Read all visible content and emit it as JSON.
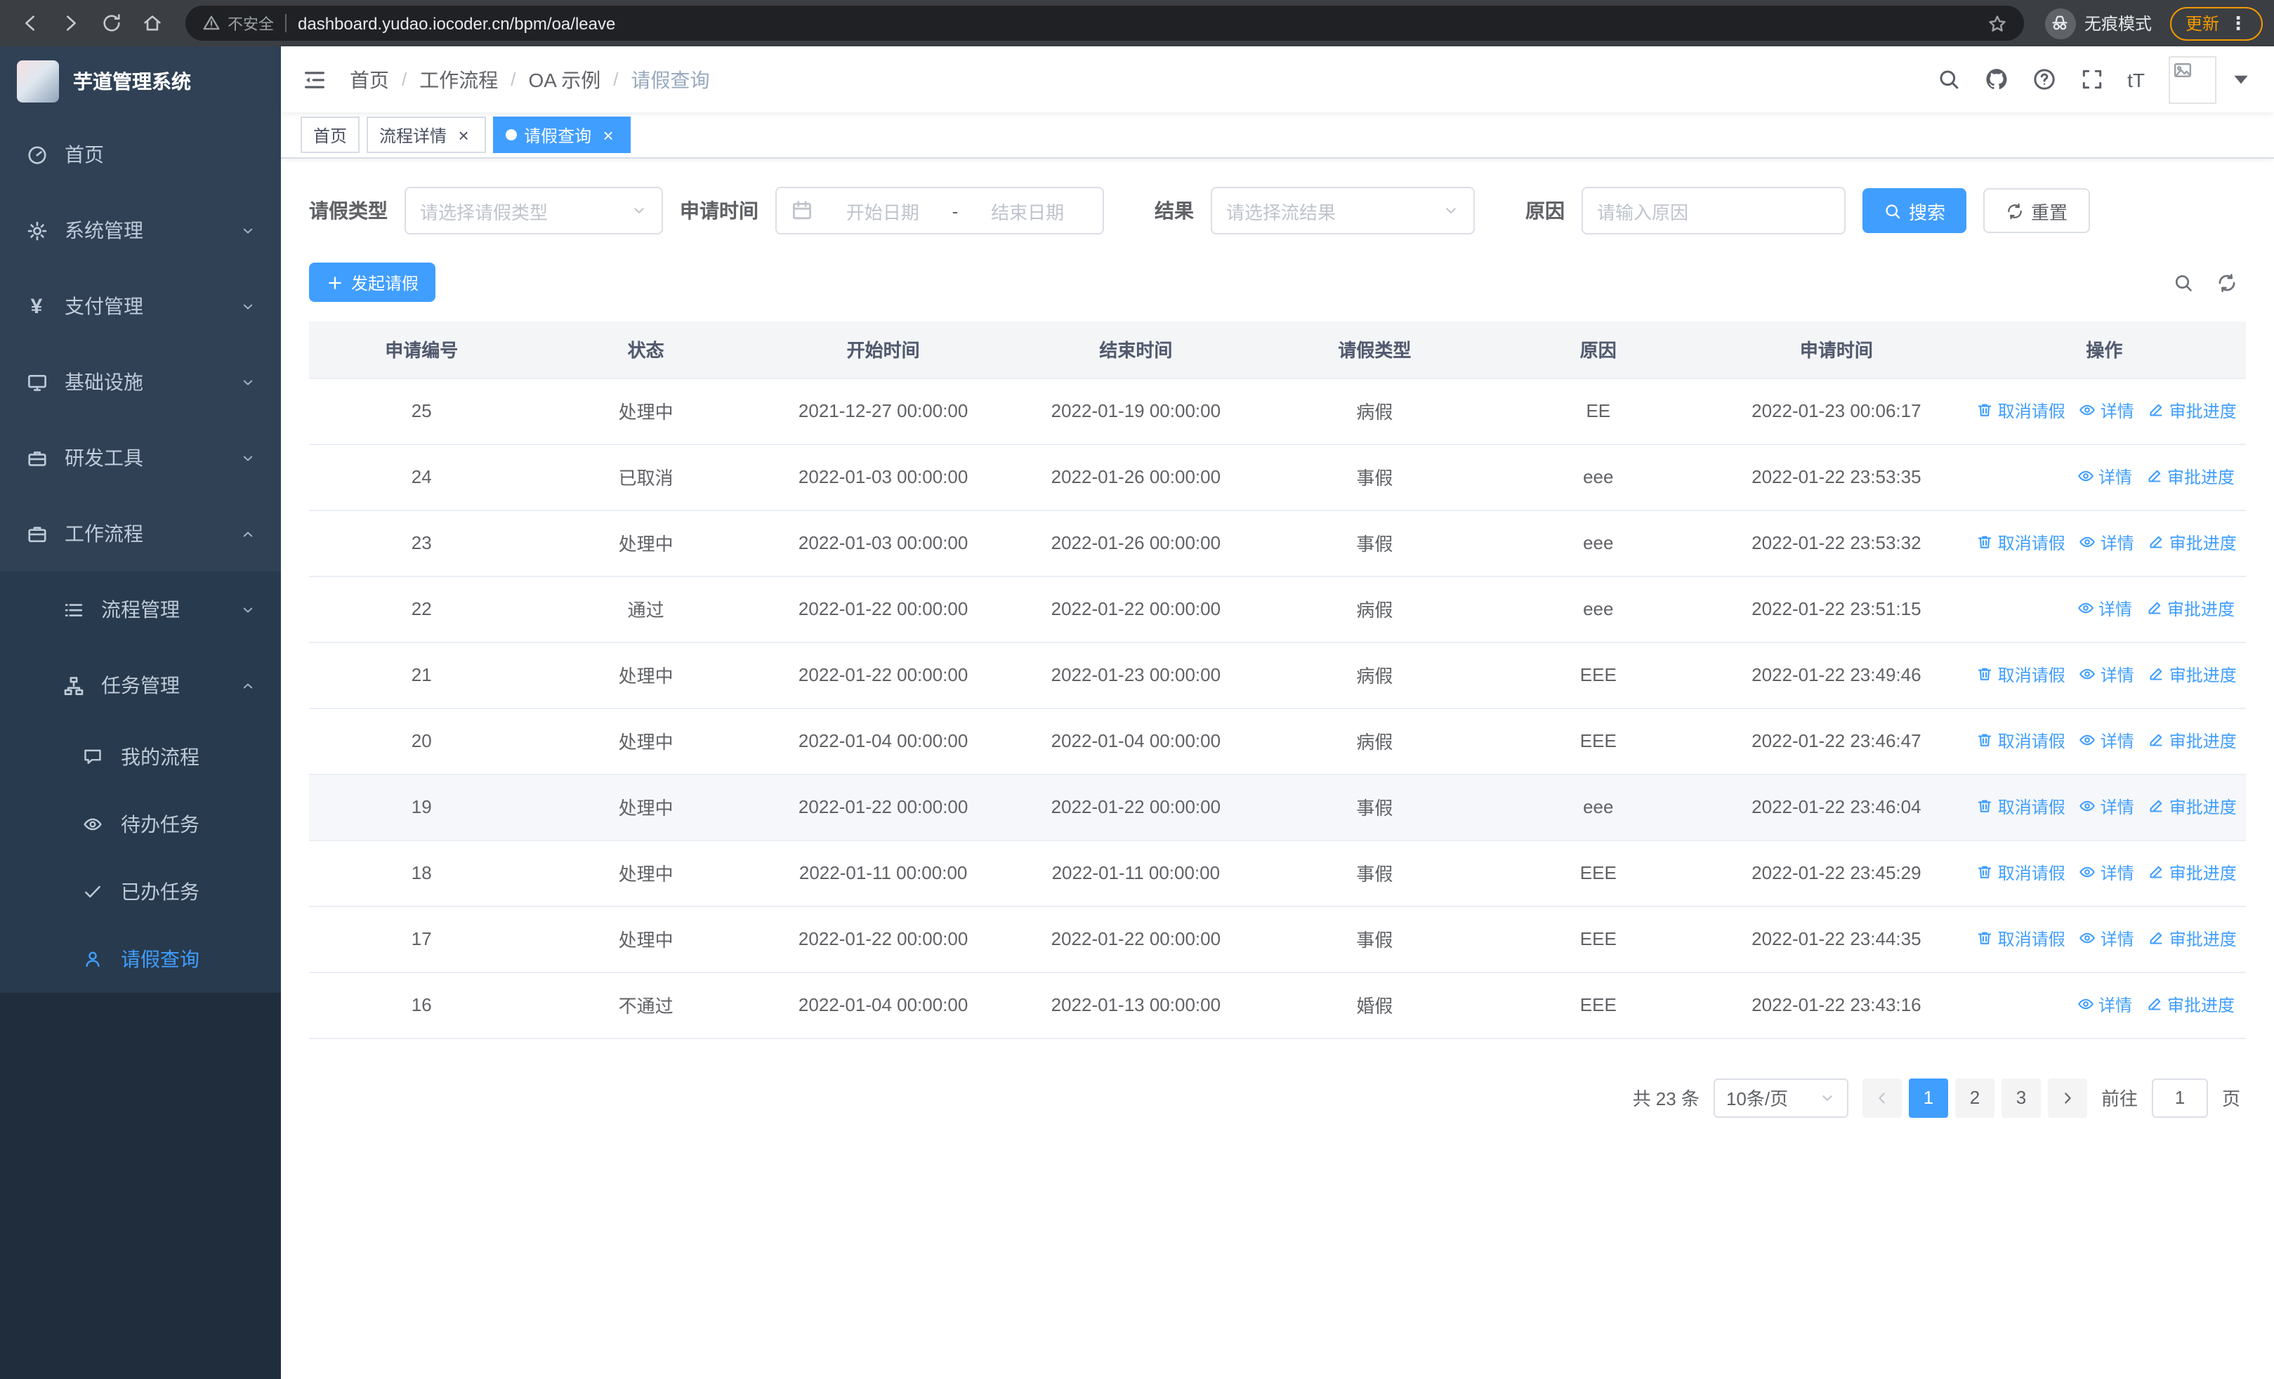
{
  "theme": {
    "accent": "#409EFF",
    "sidebar_bg": "#304156",
    "sidebar_dark_bg": "#1f2d3d",
    "table_header_bg": "#f4f5f7",
    "update_pill_color": "#f29900"
  },
  "browser": {
    "security_label": "不安全",
    "url": "dashboard.yudao.iocoder.cn/bpm/oa/leave",
    "incognito_label": "无痕模式",
    "update_label": "更新"
  },
  "icons": {
    "close": "×",
    "menu_dots": "⋮",
    "yen": "¥",
    "font_size": "tT"
  },
  "sidebar": {
    "logo_title": "芋道管理系统",
    "top_items": [
      {
        "label": "首页"
      },
      {
        "label": "系统管理"
      },
      {
        "label": "支付管理"
      },
      {
        "label": "基础设施"
      },
      {
        "label": "研发工具"
      },
      {
        "label": "工作流程"
      }
    ],
    "workflow_children": [
      {
        "label": "流程管理"
      },
      {
        "label": "任务管理"
      }
    ],
    "task_children": [
      {
        "label": "我的流程"
      },
      {
        "label": "待办任务"
      },
      {
        "label": "已办任务"
      },
      {
        "label": "请假查询"
      }
    ]
  },
  "header": {
    "breadcrumb": [
      "首页",
      "工作流程",
      "OA 示例",
      "请假查询"
    ],
    "separator": "/"
  },
  "tabs": [
    {
      "label": "首页"
    },
    {
      "label": "流程详情"
    },
    {
      "label": "请假查询"
    }
  ],
  "filters": {
    "leave_type_label": "请假类型",
    "leave_type_placeholder": "请选择请假类型",
    "apply_time_label": "申请时间",
    "start_date_placeholder": "开始日期",
    "date_separator": "-",
    "end_date_placeholder": "结束日期",
    "result_label": "结果",
    "result_placeholder": "请选择流结果",
    "reason_label": "原因",
    "reason_placeholder": "请输入原因",
    "search_button": "搜索",
    "reset_button": "重置"
  },
  "toolbar": {
    "create_button": "发起请假"
  },
  "table": {
    "columns": [
      "申请编号",
      "状态",
      "开始时间",
      "结束时间",
      "请假类型",
      "原因",
      "申请时间",
      "操作"
    ],
    "action_labels": {
      "cancel": "取消请假",
      "detail": "详情",
      "progress": "审批进度"
    },
    "rows": [
      {
        "id": "25",
        "status": "处理中",
        "start": "2021-12-27 00:00:00",
        "end": "2022-01-19 00:00:00",
        "type": "病假",
        "reason": "EE",
        "apply_time": "2022-01-23 00:06:17",
        "actions": [
          "cancel",
          "detail",
          "progress"
        ]
      },
      {
        "id": "24",
        "status": "已取消",
        "start": "2022-01-03 00:00:00",
        "end": "2022-01-26 00:00:00",
        "type": "事假",
        "reason": "eee",
        "apply_time": "2022-01-22 23:53:35",
        "actions": [
          "detail",
          "progress"
        ]
      },
      {
        "id": "23",
        "status": "处理中",
        "start": "2022-01-03 00:00:00",
        "end": "2022-01-26 00:00:00",
        "type": "事假",
        "reason": "eee",
        "apply_time": "2022-01-22 23:53:32",
        "actions": [
          "cancel",
          "detail",
          "progress"
        ]
      },
      {
        "id": "22",
        "status": "通过",
        "start": "2022-01-22 00:00:00",
        "end": "2022-01-22 00:00:00",
        "type": "病假",
        "reason": "eee",
        "apply_time": "2022-01-22 23:51:15",
        "actions": [
          "detail",
          "progress"
        ]
      },
      {
        "id": "21",
        "status": "处理中",
        "start": "2022-01-22 00:00:00",
        "end": "2022-01-23 00:00:00",
        "type": "病假",
        "reason": "EEE",
        "apply_time": "2022-01-22 23:49:46",
        "actions": [
          "cancel",
          "detail",
          "progress"
        ]
      },
      {
        "id": "20",
        "status": "处理中",
        "start": "2022-01-04 00:00:00",
        "end": "2022-01-04 00:00:00",
        "type": "病假",
        "reason": "EEE",
        "apply_time": "2022-01-22 23:46:47",
        "actions": [
          "cancel",
          "detail",
          "progress"
        ]
      },
      {
        "id": "19",
        "status": "处理中",
        "start": "2022-01-22 00:00:00",
        "end": "2022-01-22 00:00:00",
        "type": "事假",
        "reason": "eee",
        "apply_time": "2022-01-22 23:46:04",
        "actions": [
          "cancel",
          "detail",
          "progress"
        ],
        "highlight": true
      },
      {
        "id": "18",
        "status": "处理中",
        "start": "2022-01-11 00:00:00",
        "end": "2022-01-11 00:00:00",
        "type": "事假",
        "reason": "EEE",
        "apply_time": "2022-01-22 23:45:29",
        "actions": [
          "cancel",
          "detail",
          "progress"
        ]
      },
      {
        "id": "17",
        "status": "处理中",
        "start": "2022-01-22 00:00:00",
        "end": "2022-01-22 00:00:00",
        "type": "事假",
        "reason": "EEE",
        "apply_time": "2022-01-22 23:44:35",
        "actions": [
          "cancel",
          "detail",
          "progress"
        ]
      },
      {
        "id": "16",
        "status": "不通过",
        "start": "2022-01-04 00:00:00",
        "end": "2022-01-13 00:00:00",
        "type": "婚假",
        "reason": "EEE",
        "apply_time": "2022-01-22 23:43:16",
        "actions": [
          "detail",
          "progress"
        ]
      }
    ]
  },
  "pagination": {
    "total": "共 23 条",
    "page_size": "10条/页",
    "pages": [
      "1",
      "2",
      "3"
    ],
    "active_page": "1",
    "goto_label": "前往",
    "goto_value": "1",
    "goto_suffix": "页"
  }
}
